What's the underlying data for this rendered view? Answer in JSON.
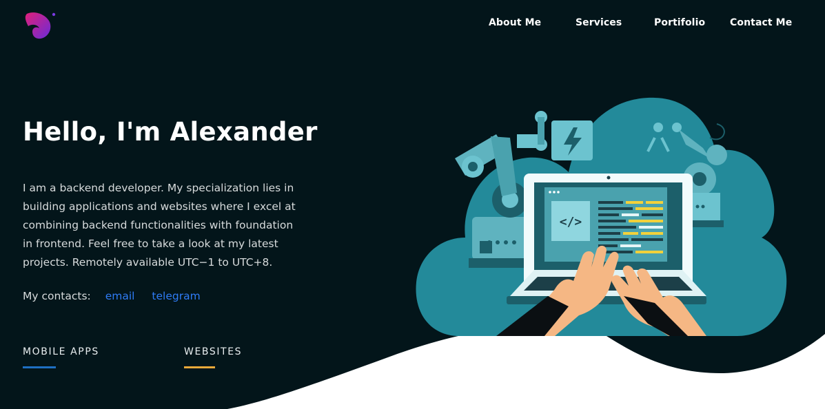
{
  "nav": {
    "items": [
      "About Me",
      "Services",
      "Portifolio",
      "Contact Me"
    ]
  },
  "hero": {
    "title": "Hello, I'm Alexander",
    "description": "I am a backend developer. My specialization lies in building applications and websites where I excel at combining backend functionalities with foundation in frontend. Feel free to take a look at my latest projects. Remotely available UTC−1 to UTC+8.",
    "contacts_label": "My contacts:",
    "contact_links": [
      "email",
      "telegram"
    ]
  },
  "tabs": [
    {
      "label": "MOBILE APPS",
      "accent": "#1f6fc2"
    },
    {
      "label": "WEBSITES",
      "accent": "#e9a93a"
    }
  ],
  "illustration": {
    "code_glyph": "</>"
  },
  "colors": {
    "background": "#03151a",
    "link": "#2f7cf6",
    "cloud": "#238a9a"
  }
}
